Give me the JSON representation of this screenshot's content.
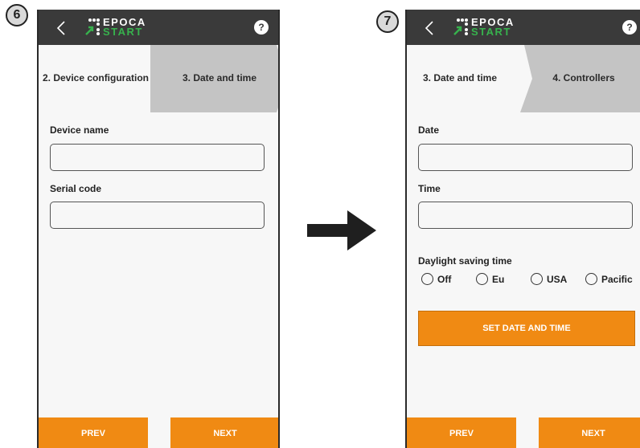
{
  "badges": {
    "left": "6",
    "right": "7"
  },
  "logo": {
    "top": "EPOCA",
    "bottom": "START"
  },
  "help_glyph": "?",
  "screen1": {
    "steps": {
      "current": "2. Device configuration",
      "next": "3. Date and time"
    },
    "fields": [
      {
        "label": "Device name",
        "value": ""
      },
      {
        "label": "Serial code",
        "value": ""
      }
    ],
    "prev": "PREV",
    "next": "NEXT"
  },
  "screen2": {
    "steps": {
      "current": "3. Date and time",
      "next": "4. Controllers"
    },
    "fields": [
      {
        "label": "Date",
        "value": ""
      },
      {
        "label": "Time",
        "value": ""
      }
    ],
    "dst": {
      "label": "Daylight saving time",
      "options": [
        "Off",
        "Eu",
        "USA",
        "Pacific"
      ]
    },
    "action": "SET DATE AND TIME",
    "prev": "PREV",
    "next": "NEXT"
  },
  "colors": {
    "accent": "#f08a13",
    "appbar": "#3a3a3a",
    "brand_green": "#37b24d",
    "step_grey": "#c4c4c4"
  }
}
